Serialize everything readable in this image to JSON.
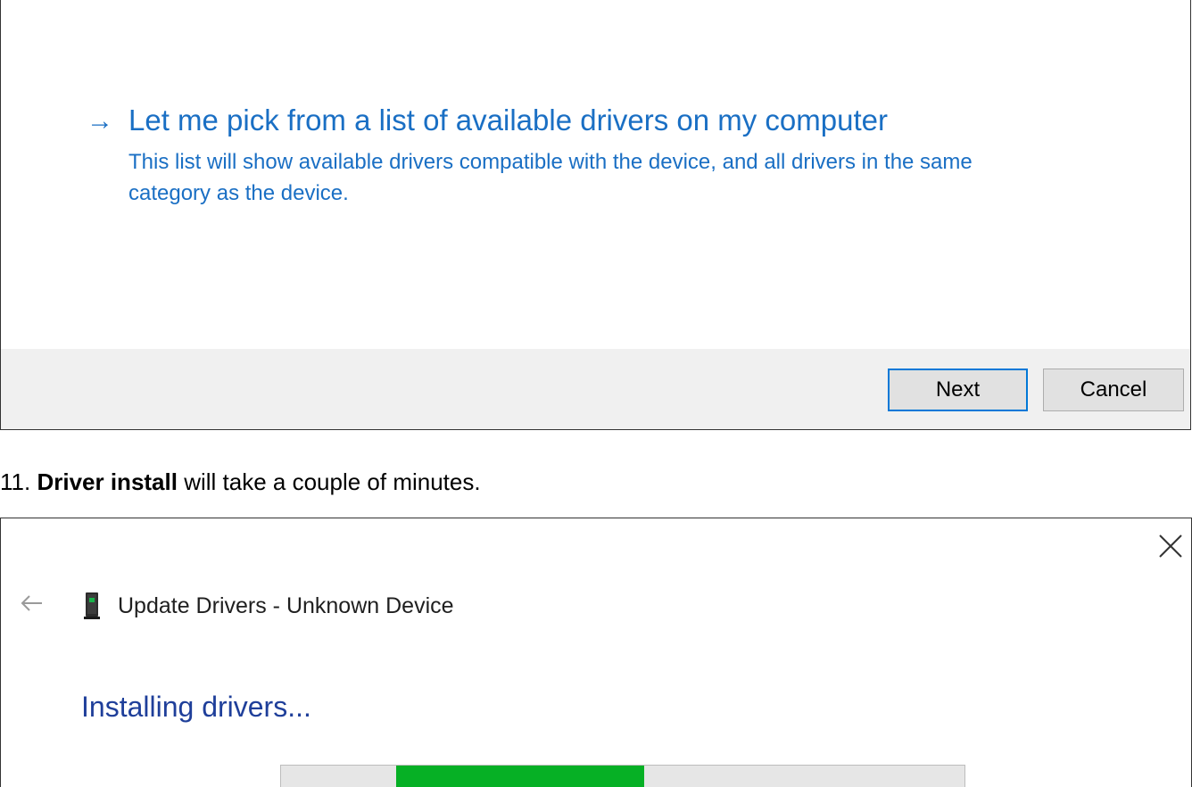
{
  "top_dialog": {
    "option_arrow": "→",
    "option_title": "Let me pick from a list of available drivers on my computer",
    "option_description": "This list will show available drivers compatible with the device, and all drivers in the same category as the device.",
    "next_label": "Next",
    "cancel_label": "Cancel",
    "focus_color": "#0078d7"
  },
  "step": {
    "number": "11.",
    "bold": "Driver install",
    "rest": " will take a couple of minutes."
  },
  "bottom_dialog": {
    "title": "Update Drivers - Unknown Device",
    "heading": "Installing drivers...",
    "close_icon": "close-icon",
    "back_icon": "back-arrow-icon",
    "device_icon": "device-icon",
    "progress": {
      "start_fraction": 0.168,
      "end_fraction": 0.531,
      "fill_color": "#06b025"
    }
  }
}
